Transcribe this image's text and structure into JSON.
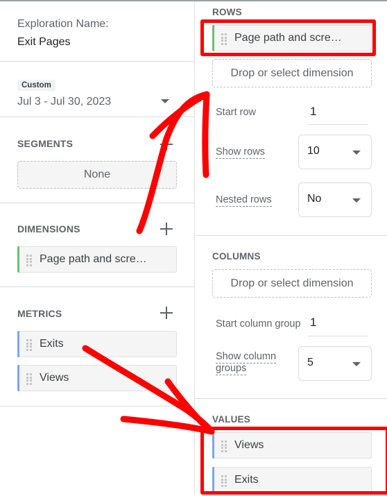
{
  "exploration": {
    "name_label": "Exploration Name:",
    "name_value": "Exit Pages"
  },
  "date": {
    "preset": "Custom",
    "range": "Jul 3 - Jul 30, 2023"
  },
  "segments": {
    "heading": "SEGMENTS",
    "value": "None"
  },
  "dimensions": {
    "heading": "DIMENSIONS",
    "items": [
      {
        "label": "Page path and scre…",
        "color": "#6cc070"
      }
    ]
  },
  "metrics": {
    "heading": "METRICS",
    "items": [
      {
        "label": "Exits",
        "color": "#7aa7f0"
      },
      {
        "label": "Views",
        "color": "#7aa7f0"
      }
    ]
  },
  "rows": {
    "heading": "ROWS",
    "item": {
      "label": "Page path and scre…",
      "color": "#6cc070"
    },
    "drop_label": "Drop or select dimension",
    "start_row_label": "Start row",
    "start_row_value": "1",
    "show_rows_label": "Show rows",
    "show_rows_value": "10",
    "nested_rows_label": "Nested rows",
    "nested_rows_value": "No"
  },
  "columns": {
    "heading": "COLUMNS",
    "drop_label": "Drop or select dimension",
    "start_group_label": "Start column group",
    "start_group_value": "1",
    "show_groups_label_line1": "Show column",
    "show_groups_label_line2": "groups",
    "show_groups_value": "5"
  },
  "values": {
    "heading": "VALUES",
    "items": [
      {
        "label": "Views",
        "color": "#7aa7f0"
      },
      {
        "label": "Exits",
        "color": "#7aa7f0"
      }
    ]
  },
  "annotation": {
    "color": "#ff0000"
  }
}
